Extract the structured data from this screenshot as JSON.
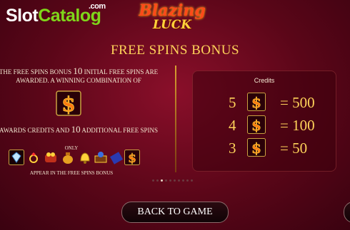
{
  "watermark": {
    "slot": "Slot",
    "catalog": "Catalog",
    "com": ".com"
  },
  "logo": {
    "line1": "Blazing",
    "line2": "LUCK"
  },
  "title": "FREE SPINS BONUS",
  "left": {
    "text1_a": "THE FREE SPINS BONUS ",
    "text1_num": "10",
    "text1_b": " INITIAL FREE SPINS ARE AWARDED. A WINNING COMBINATION OF",
    "text2_a": "AWARDS CREDITS AND ",
    "text2_num": "10",
    "text2_b": " ADDITIONAL FREE SPINS",
    "only": "ONLY",
    "appear": "APPEAR IN THE FREE SPINS BONUS",
    "icons": [
      "diamond-icon",
      "ring-icon",
      "coin-bag-icon",
      "money-bag-icon",
      "bell-icon",
      "chest-icon",
      "gift-icon",
      "dollar-scatter-icon"
    ]
  },
  "paytable": {
    "header": "Credits",
    "rows": [
      {
        "count": "5",
        "value": "= 500"
      },
      {
        "count": "4",
        "value": "= 100"
      },
      {
        "count": "3",
        "value": "= 50"
      }
    ]
  },
  "pager": {
    "total": 10,
    "active": 3
  },
  "buttons": {
    "back": "BACK TO GAME"
  },
  "colors": {
    "gold": "#ffd35a",
    "bg": "#5a0618",
    "accent_green": "#7fd61a"
  }
}
